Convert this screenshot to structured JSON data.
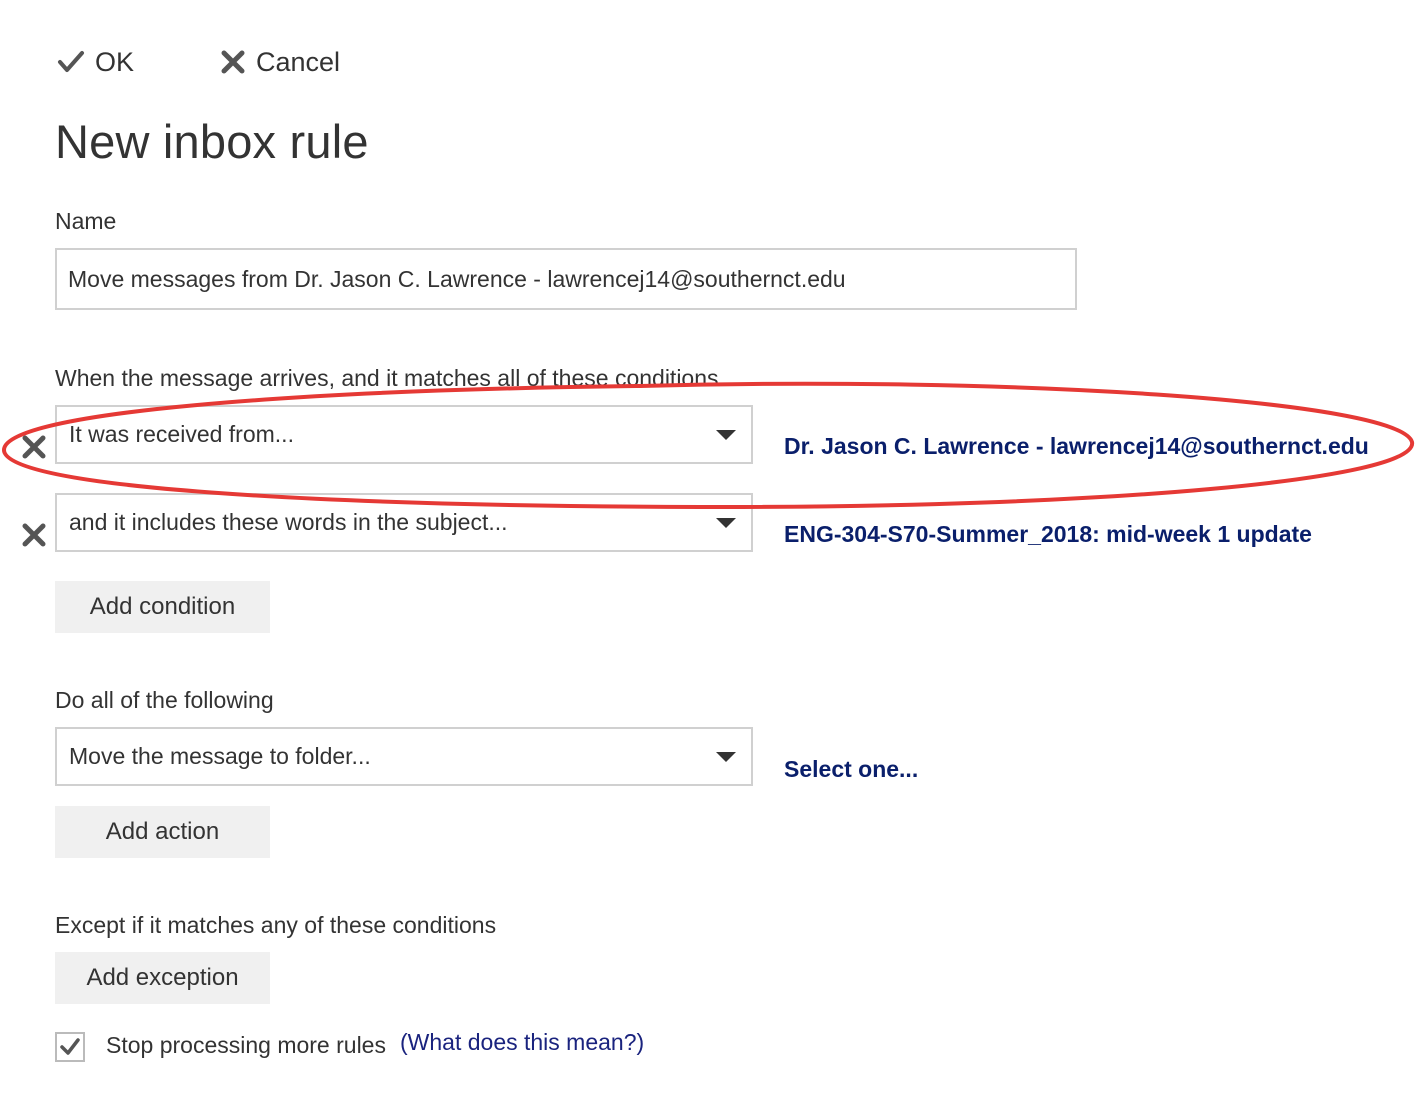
{
  "toolbar": {
    "ok_label": "OK",
    "cancel_label": "Cancel"
  },
  "title": "New inbox rule",
  "name_section": {
    "label": "Name",
    "value": "Move messages from Dr. Jason C. Lawrence - lawrencej14@southernct.edu"
  },
  "conditions": {
    "label": "When the message arrives, and it matches all of these conditions",
    "items": [
      {
        "select": "It was received from...",
        "value": "Dr. Jason C. Lawrence - lawrencej14@southernct.edu"
      },
      {
        "select": "and it includes these words in the subject...",
        "value": "ENG-304-S70-Summer_2018: mid-week 1 update"
      }
    ],
    "add_label": "Add condition"
  },
  "actions": {
    "label": "Do all of the following",
    "items": [
      {
        "select": "Move the message to folder...",
        "value": "Select one..."
      }
    ],
    "add_label": "Add action"
  },
  "exceptions": {
    "label": "Except if it matches any of these conditions",
    "add_label": "Add exception"
  },
  "stop_processing": {
    "checked": true,
    "label": "Stop processing more rules",
    "help_link": "(What does this mean?)"
  },
  "colors": {
    "link": "#0a1f6b",
    "annotation": "#e53935",
    "button_bg": "#f0f0f0",
    "border": "#d0d0d0"
  },
  "icons": {
    "ok": "checkmark-icon",
    "cancel": "close-icon",
    "remove": "remove-x-icon",
    "dropdown": "caret-down-icon",
    "checkbox": "checkmark-icon"
  }
}
